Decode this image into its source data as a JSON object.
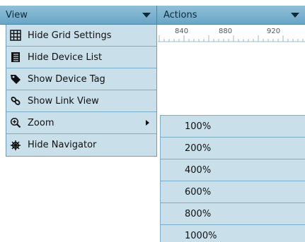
{
  "topbar": {
    "view_label": "View",
    "actions_label": "Actions"
  },
  "ruler": {
    "labels": [
      "840",
      "880",
      "920"
    ]
  },
  "view_menu": {
    "items": [
      {
        "label": "Hide Grid Settings",
        "icon": "grid-icon"
      },
      {
        "label": "Hide Device List",
        "icon": "list-icon"
      },
      {
        "label": "Show Device Tag",
        "icon": "tag-icon"
      },
      {
        "label": "Show Link View",
        "icon": "link-icon"
      },
      {
        "label": "Zoom",
        "icon": "zoom-in-icon",
        "has_submenu": true
      },
      {
        "label": "Hide Navigator",
        "icon": "navigator-icon"
      }
    ]
  },
  "zoom_submenu": {
    "items": [
      "100%",
      "200%",
      "400%",
      "600%",
      "800%",
      "1000%"
    ]
  },
  "colors": {
    "header_gradient_top": "#8fc0d8",
    "header_gradient_bottom": "#6aa6c6",
    "menu_item_bg": "#c9dfea",
    "menu_border": "#7eaec6"
  }
}
